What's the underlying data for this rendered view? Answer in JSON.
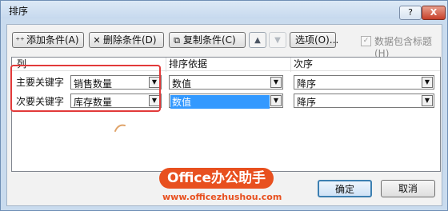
{
  "window": {
    "title": "排序",
    "help_label": "?",
    "close_label": "X"
  },
  "toolbar": {
    "add_label": "添加条件(A)",
    "delete_label": "删除条件(D)",
    "copy_label": "复制条件(C)",
    "up_arrow": "▲",
    "down_arrow": "▼",
    "options_label": "选项(O)...",
    "header_checkbox_label": "数据包含标题(H)",
    "header_checkbox_checked": true
  },
  "grid": {
    "headers": {
      "column": "列",
      "sort_on": "排序依据",
      "order": "次序"
    },
    "rows": [
      {
        "label": "主要关键字",
        "column_value": "销售数量",
        "sort_on_value": "数值",
        "order_value": "降序"
      },
      {
        "label": "次要关键字",
        "column_value": "库存数量",
        "sort_on_value": "数值",
        "order_value": "降序"
      }
    ]
  },
  "buttons": {
    "ok_label": "确定",
    "cancel_label": "取消"
  },
  "watermark": {
    "brand": "Office办公助手",
    "url": "www.officezhushou.com"
  },
  "colors": {
    "highlight": "#e23a3a",
    "selection": "#3399ff",
    "watermark": "#e8501f"
  }
}
